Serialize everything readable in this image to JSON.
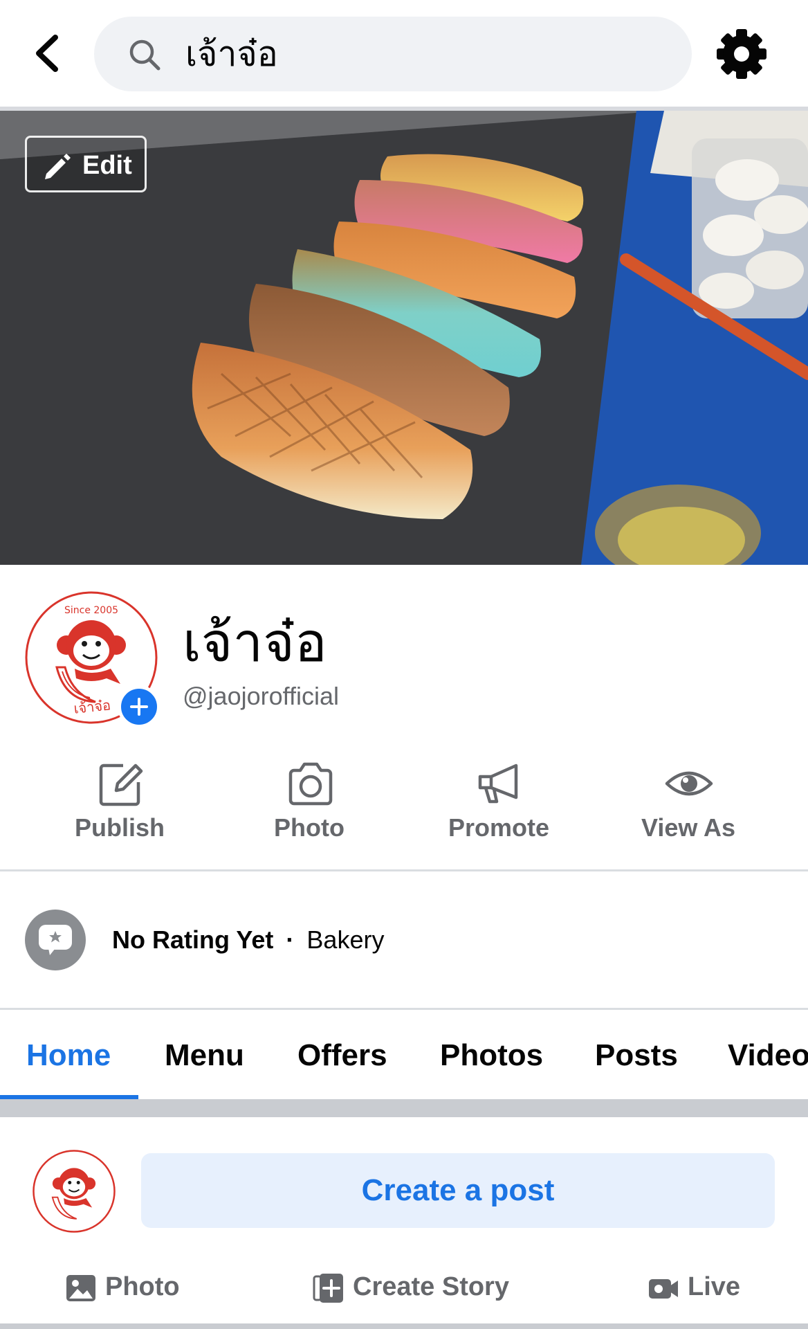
{
  "search": {
    "query": "เจ้าจ๋อ"
  },
  "cover": {
    "edit_label": "Edit"
  },
  "profile": {
    "name": "เจ้าจ๋อ",
    "handle": "@jaojorofficial",
    "logo_text_top": "Since 2005",
    "logo_text_bottom": "เจ้าจ๋อ"
  },
  "actions": [
    {
      "label": "Publish",
      "icon": "edit-square-icon"
    },
    {
      "label": "Photo",
      "icon": "camera-icon"
    },
    {
      "label": "Promote",
      "icon": "megaphone-icon"
    },
    {
      "label": "View As",
      "icon": "eye-icon"
    }
  ],
  "rating": {
    "text": "No Rating Yet",
    "separator": "·",
    "category": "Bakery"
  },
  "tabs": [
    "Home",
    "Menu",
    "Offers",
    "Photos",
    "Posts",
    "Videos"
  ],
  "active_tab": "Home",
  "composer": {
    "create_post_label": "Create a post",
    "photo_label": "Photo",
    "story_label": "Create Story",
    "live_label": "Live"
  },
  "colors": {
    "accent": "#1b74e4",
    "muted_text": "#65676b",
    "search_bg": "#f0f2f5",
    "logo_red": "#d9342b"
  }
}
